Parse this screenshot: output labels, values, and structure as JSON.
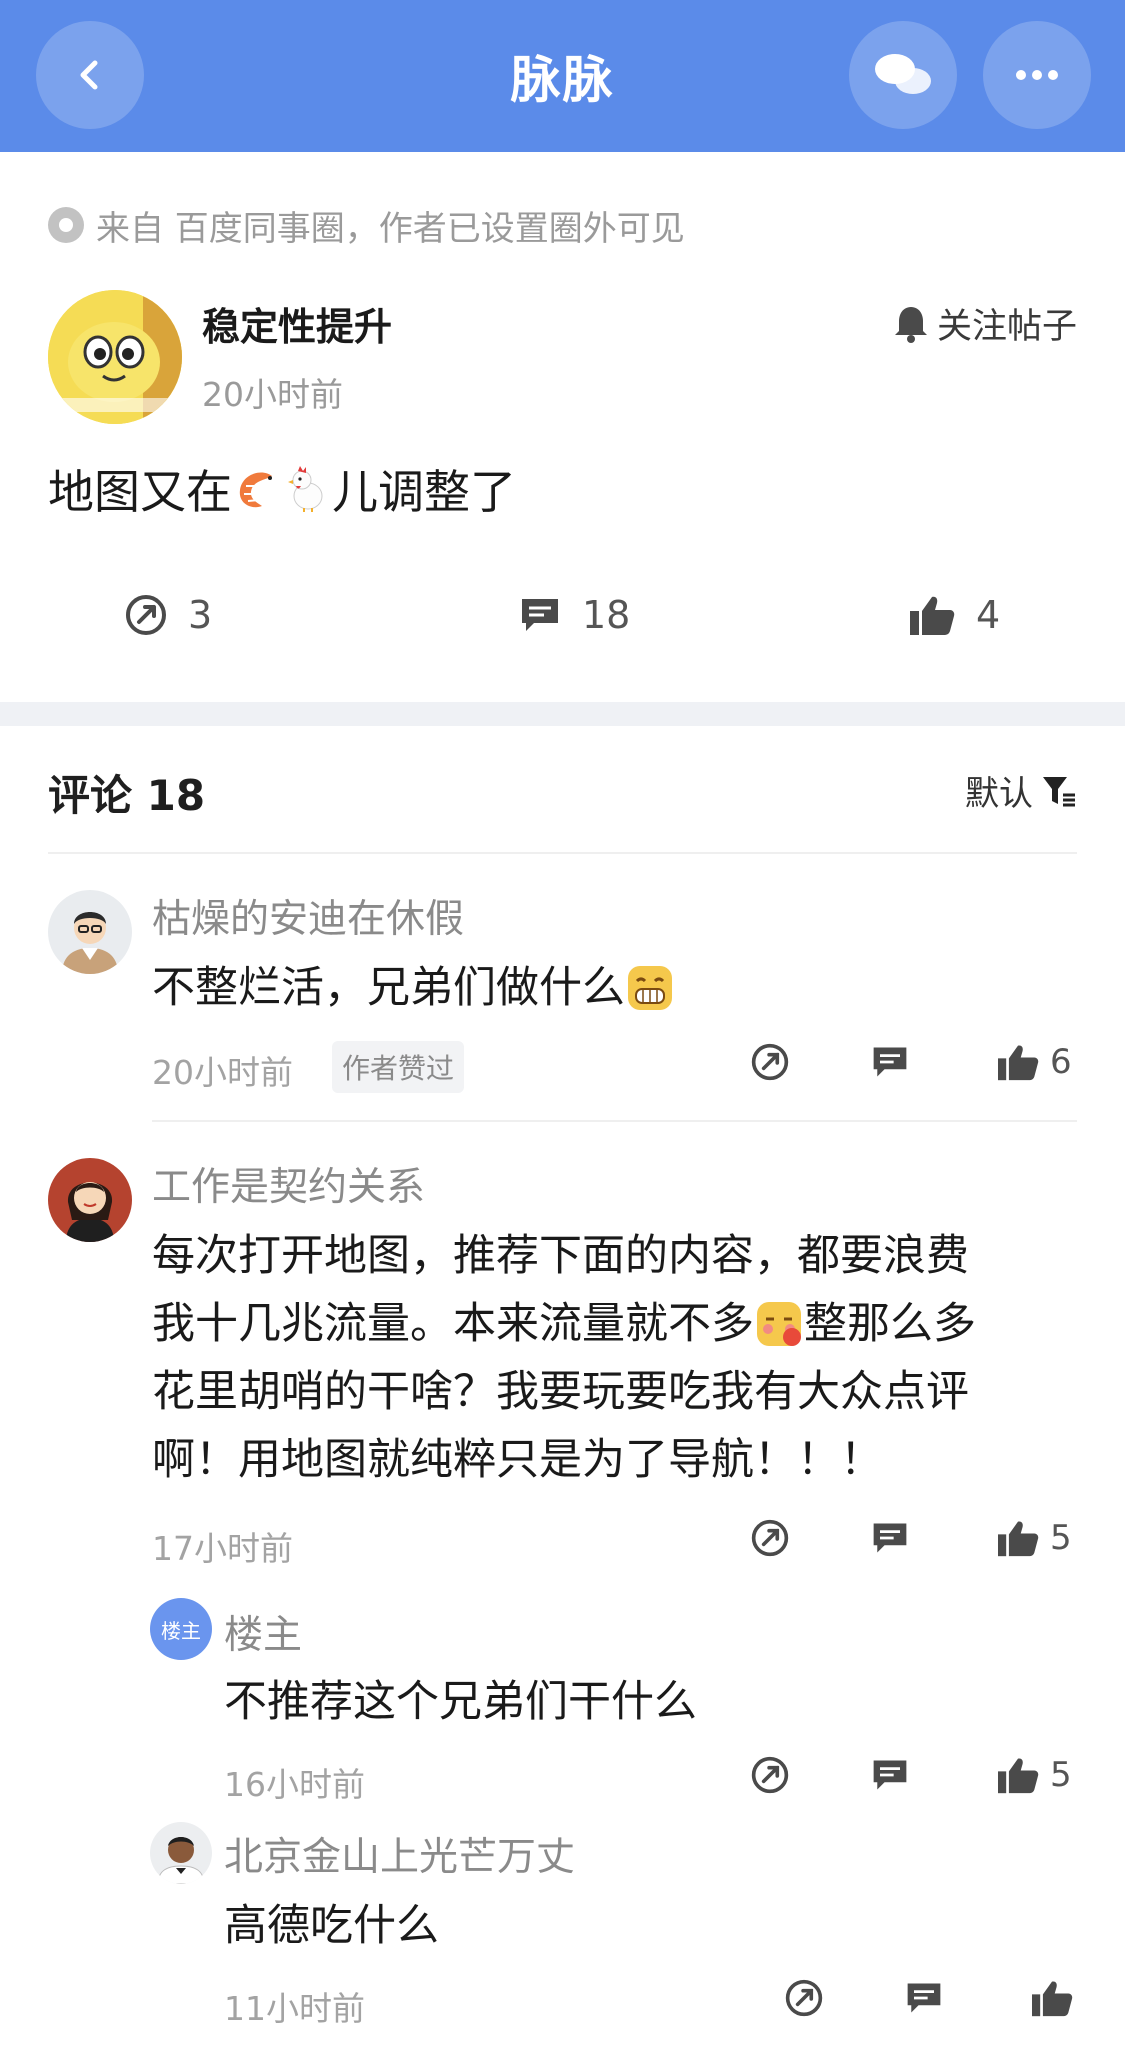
{
  "header": {
    "title": "脉脉"
  },
  "post": {
    "source": "来自 百度同事圈，作者已设置圈外可见",
    "author": "稳定性提升",
    "time": "20小时前",
    "follow_label": "关注帖子",
    "body_before": "地图又在",
    "body_after": "儿调整了",
    "body_emojis": [
      "shrimp-emoji",
      "chicken-emoji"
    ],
    "share_count": "3",
    "comment_count": "18",
    "like_count": "4"
  },
  "comments_header": {
    "title": "评论 18",
    "sort_label": "默认"
  },
  "comments": [
    {
      "name": "枯燥的安迪在休假",
      "text": "不整烂活，兄弟们做什么",
      "time": "20小时前",
      "tag": "作者赞过",
      "likes": "6"
    },
    {
      "name": "工作是契约关系",
      "lines": [
        "每次打开地图，推荐下面的内容，都要浪费",
        "我十几兆流量。本来流量就不多",
        "整那么多",
        "花里胡哨的干啥？我要玩要吃我有大众点评",
        "啊！用地图就纯粹只是为了导航！！！"
      ],
      "time": "17小时前",
      "likes": "5"
    }
  ],
  "replies": [
    {
      "badge": "楼主",
      "name": "楼主",
      "text": "不推荐这个兄弟们干什么",
      "time": "16小时前",
      "likes": "5"
    },
    {
      "name": "北京金山上光芒万丈",
      "text": "高德吃什么",
      "time": "11小时前"
    }
  ],
  "colors": {
    "header_bg": "#5b8be9",
    "accent": "#6a95ee"
  }
}
